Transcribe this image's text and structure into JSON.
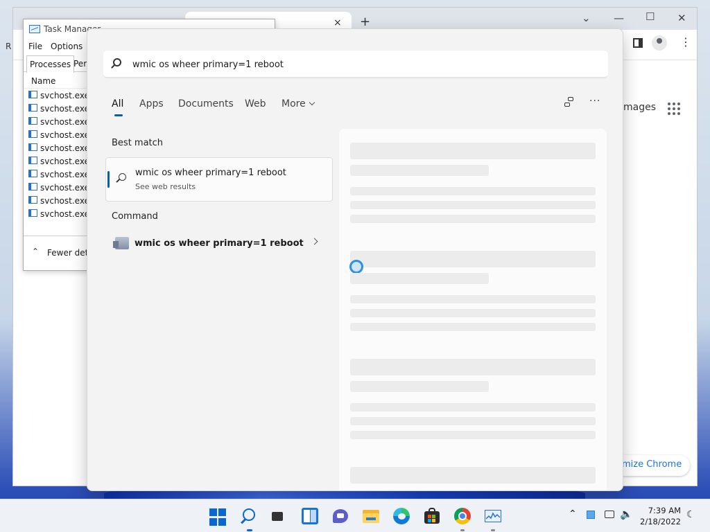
{
  "desktop": {
    "edge_letters": [
      "R"
    ]
  },
  "chrome": {
    "google_images_label": "mages",
    "customize_button": "mize Chrome",
    "new_tab_glyph": "+",
    "close_tab_glyph": "×",
    "kebab_glyph": "⋮"
  },
  "task_manager": {
    "title": "Task Manager",
    "menu": [
      "File",
      "Options"
    ],
    "tabs": [
      "Processes",
      "Perf"
    ],
    "column_name": "Name",
    "processes": [
      "svchost.exe",
      "svchost.exe",
      "svchost.exe",
      "svchost.exe",
      "svchost.exe",
      "svchost.exe",
      "svchost.exe",
      "svchost.exe",
      "svchost.exe",
      "svchost.exe"
    ],
    "fewer_details": "Fewer deta"
  },
  "search": {
    "query": "wmic os wheer primary=1 reboot",
    "tabs": [
      {
        "label": "All",
        "active": true
      },
      {
        "label": "Apps"
      },
      {
        "label": "Documents"
      },
      {
        "label": "Web"
      },
      {
        "label": "More"
      }
    ],
    "best_match": {
      "heading": "Best match",
      "title": "wmic os wheer primary=1 reboot",
      "subtitle": "See web results"
    },
    "command": {
      "heading": "Command",
      "title": "wmic os wheer primary=1 reboot"
    },
    "ellipsis": "···"
  },
  "taskbar": {
    "apps": [
      "start-icon",
      "search-icon",
      "task-view-icon",
      "widgets-icon",
      "chat-icon",
      "file-explorer-icon",
      "edge-icon",
      "store-icon",
      "chrome-icon",
      "task-manager-icon"
    ],
    "clock": {
      "time": "7:39 AM",
      "date": "2/18/2022"
    },
    "accent_color": "#0a67d0"
  }
}
